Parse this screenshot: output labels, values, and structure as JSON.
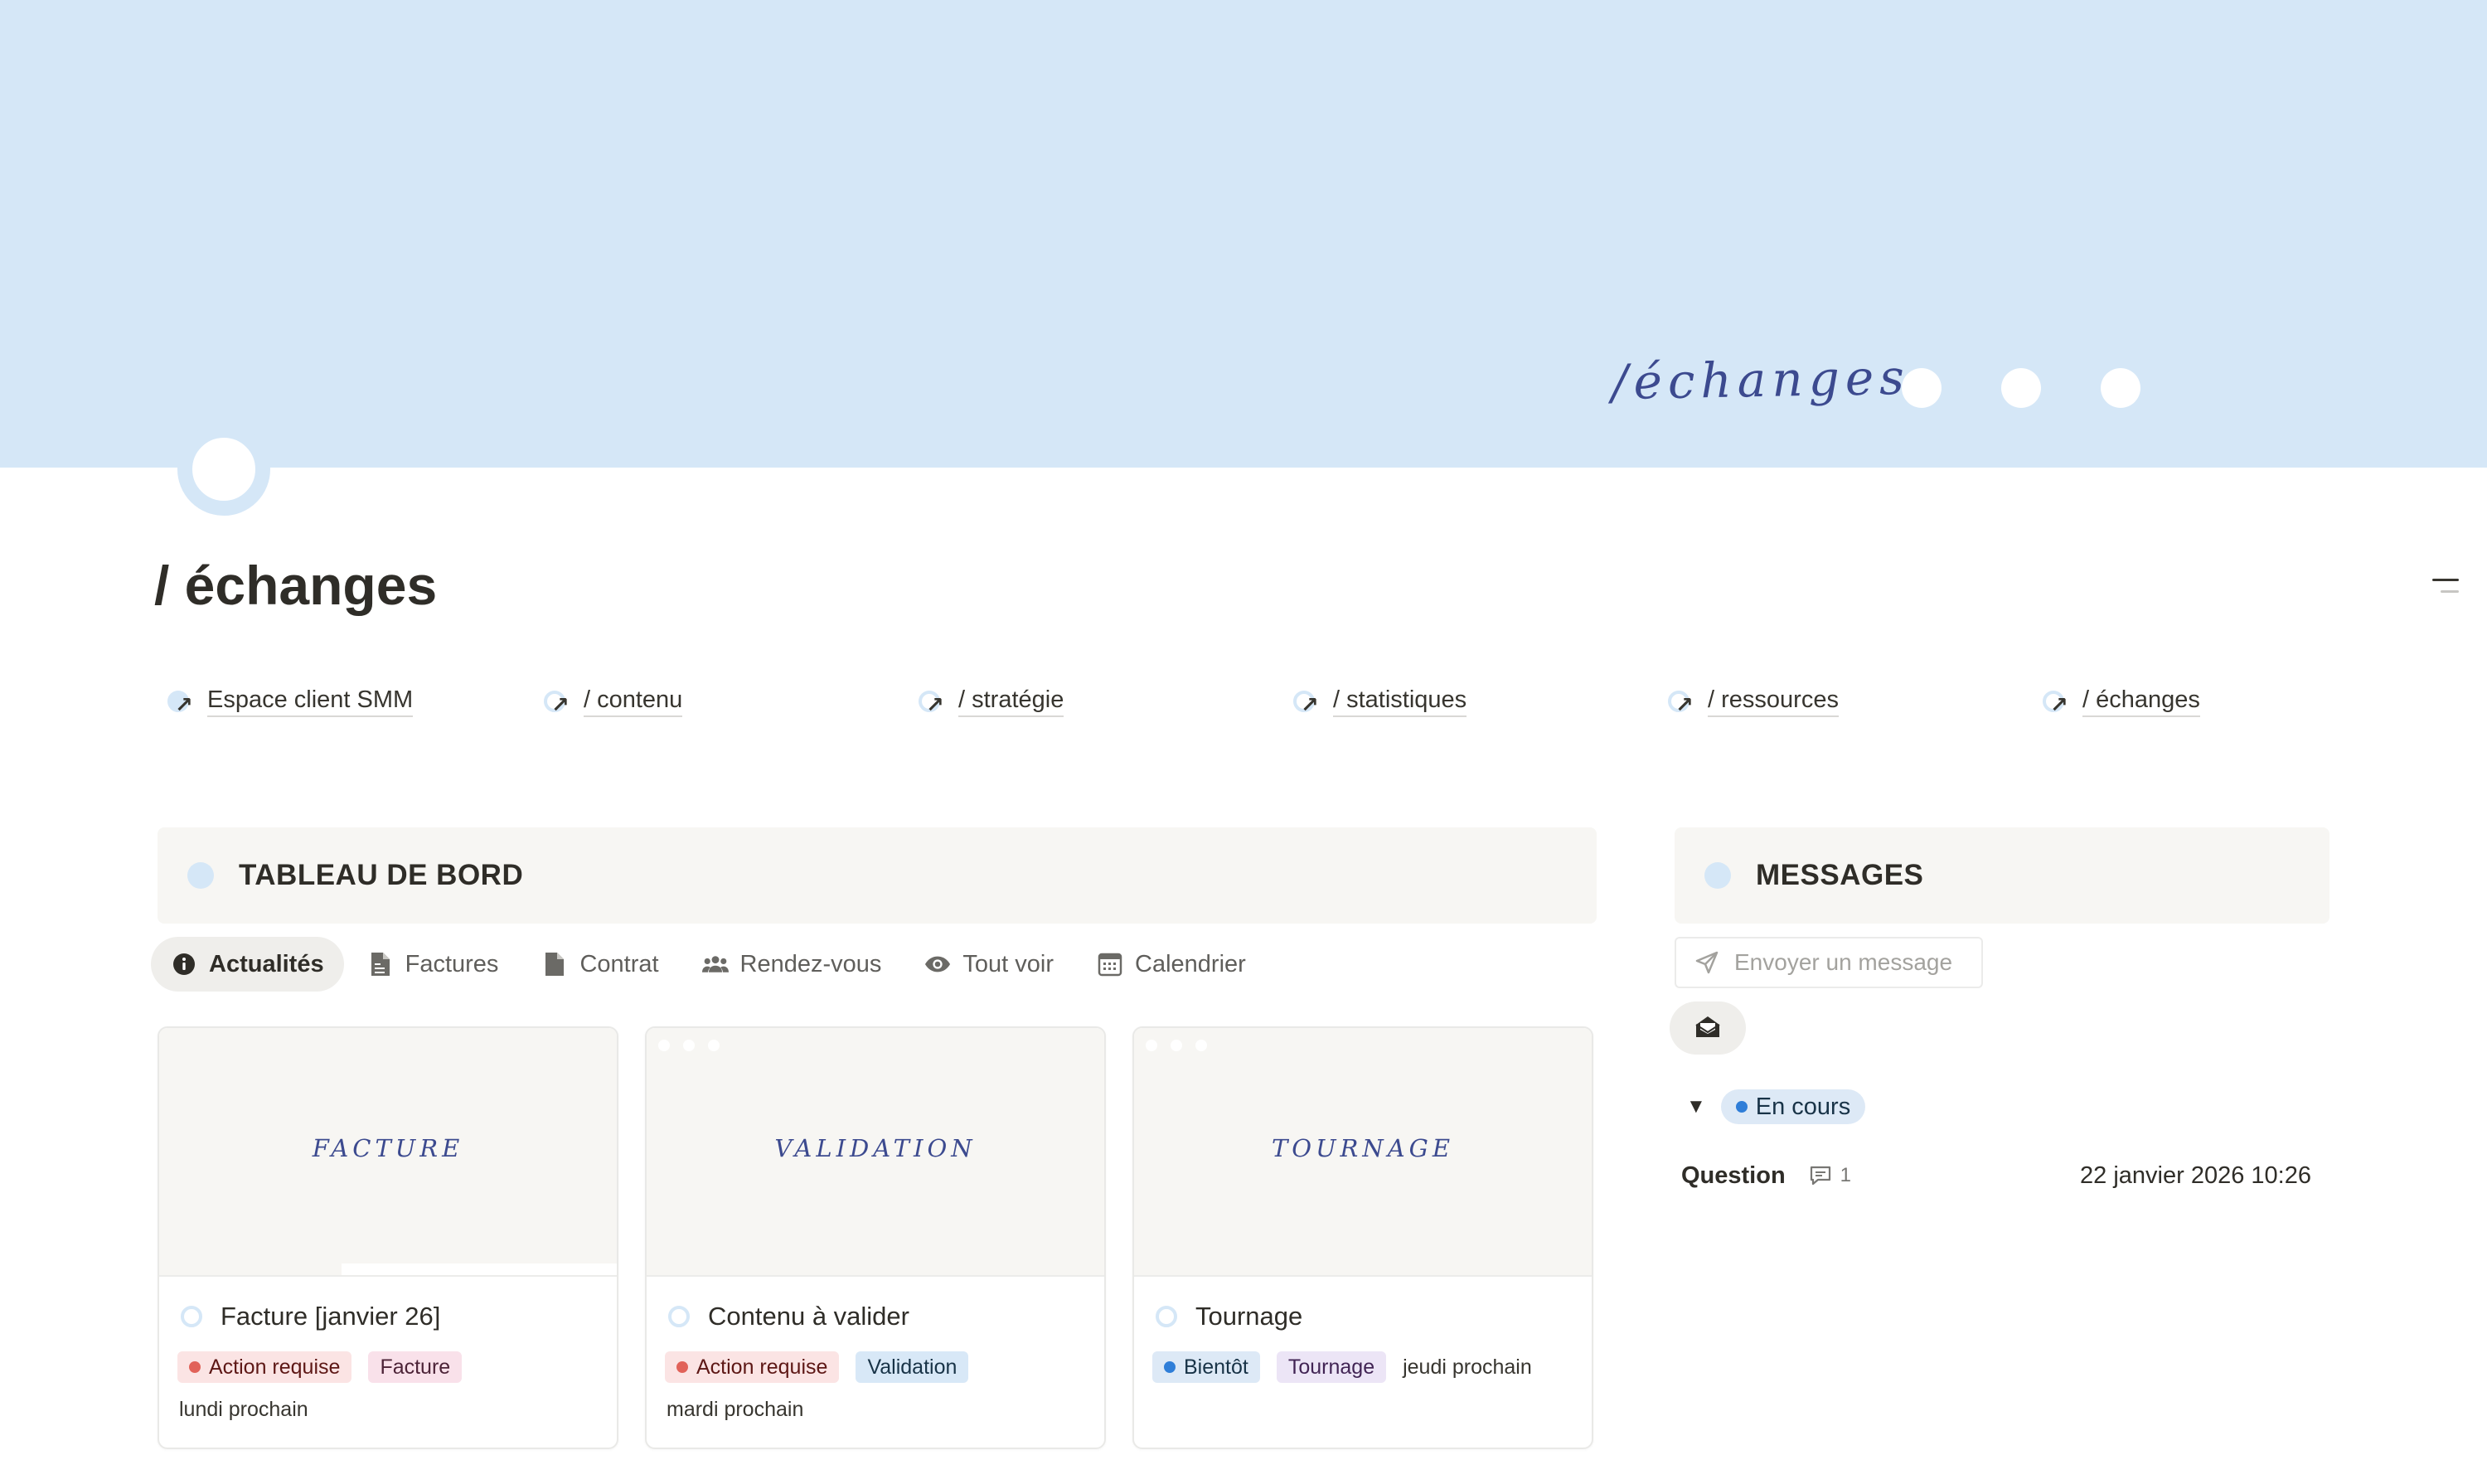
{
  "cover": {
    "word": "/échanges"
  },
  "page": {
    "title": "/ échanges"
  },
  "nav_links": [
    {
      "label": "Espace client SMM",
      "icon": "page-circle-icon"
    },
    {
      "label": "/ contenu",
      "icon": "page-circle-icon"
    },
    {
      "label": "/ stratégie",
      "icon": "page-circle-icon"
    },
    {
      "label": "/ statistiques",
      "icon": "page-circle-icon"
    },
    {
      "label": "/ ressources",
      "icon": "page-circle-icon"
    },
    {
      "label": "/ échanges",
      "icon": "page-circle-icon"
    }
  ],
  "dashboard": {
    "title": "TABLEAU DE BORD",
    "tabs": [
      {
        "label": "Actualités",
        "icon": "info-icon",
        "active": true
      },
      {
        "label": "Factures",
        "icon": "invoice-icon",
        "active": false
      },
      {
        "label": "Contrat",
        "icon": "document-icon",
        "active": false
      },
      {
        "label": "Rendez-vous",
        "icon": "people-icon",
        "active": false
      },
      {
        "label": "Tout voir",
        "icon": "eye-icon",
        "active": false
      },
      {
        "label": "Calendrier",
        "icon": "calendar-icon",
        "active": false
      }
    ],
    "cards": [
      {
        "cover_word": "FACTURE",
        "title": "Facture [janvier 26]",
        "status": "Action requise",
        "category": "Facture",
        "date": "lundi prochain"
      },
      {
        "cover_word": "VALIDATION",
        "title": "Contenu à valider",
        "status": "Action requise",
        "category": "Validation",
        "date": "mardi prochain"
      },
      {
        "cover_word": "TOURNAGE",
        "title": "Tournage",
        "status": "Bientôt",
        "category": "Tournage",
        "date": "jeudi prochain"
      }
    ]
  },
  "messages": {
    "title": "MESSAGES",
    "send_placeholder": "Envoyer un message",
    "group_label": "En cours",
    "items": [
      {
        "title": "Question",
        "comment_count": "1",
        "datetime": "22 janvier 2026 10:26"
      }
    ]
  },
  "colors": {
    "cover_bg": "#d5e7f7",
    "accent_blue": "#2f7ed8",
    "status_red": "#e16259",
    "text": "#37352f"
  }
}
